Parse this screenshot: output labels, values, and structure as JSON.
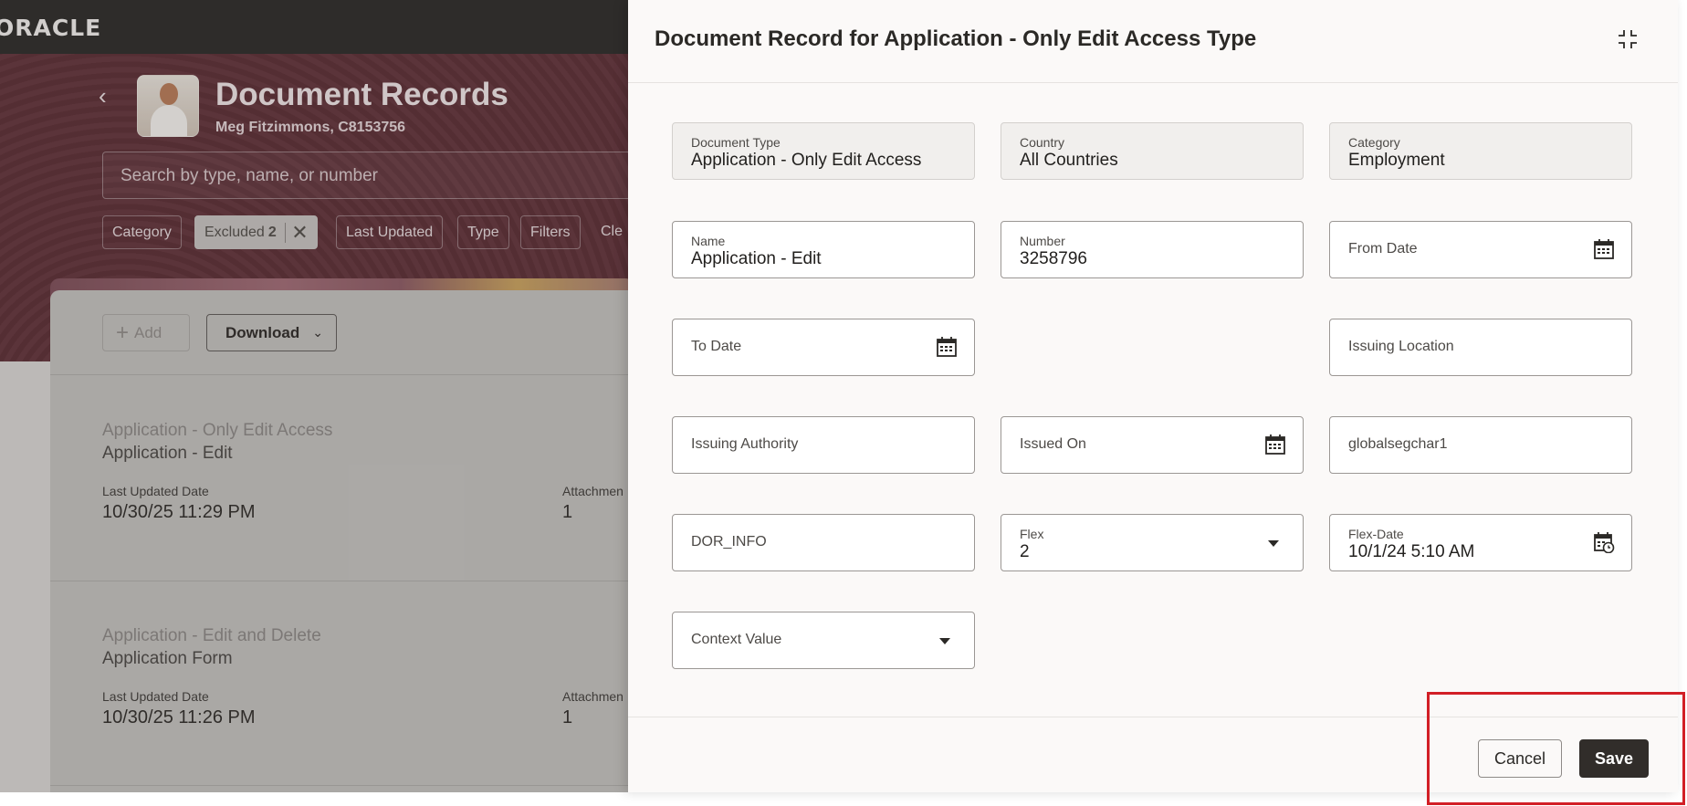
{
  "app": {
    "logo": "ORACLE"
  },
  "background": {
    "title": "Document Records",
    "subtitle": "Meg Fitzimmons, C8153756",
    "search_placeholder": "Search by type, name, or number",
    "chips": [
      {
        "label": "Category"
      },
      {
        "label": "Excluded",
        "count": "2"
      },
      {
        "label": "Last Updated"
      },
      {
        "label": "Type"
      },
      {
        "label": "Filters"
      },
      {
        "label": "Cle"
      }
    ],
    "add_label": "Add",
    "download_label": "Download",
    "records": [
      {
        "title": "Application - Only Edit Access",
        "name": "Application - Edit",
        "updated_label": "Last Updated Date",
        "updated": "10/30/25 11:29 PM",
        "attach_label": "Attachmen",
        "attach": "1"
      },
      {
        "title": "Application - Edit and Delete",
        "name": "Application Form",
        "updated_label": "Last Updated Date",
        "updated": "10/30/25 11:26 PM",
        "attach_label": "Attachmen",
        "attach": "1"
      }
    ]
  },
  "drawer": {
    "title": "Document Record for Application - Only Edit Access Type",
    "fields": {
      "document_type": {
        "label": "Document Type",
        "value": "Application - Only Edit Access"
      },
      "country": {
        "label": "Country",
        "value": "All Countries"
      },
      "category": {
        "label": "Category",
        "value": "Employment"
      },
      "name": {
        "label": "Name",
        "value": "Application - Edit"
      },
      "number": {
        "label": "Number",
        "value": "3258796"
      },
      "from_date": {
        "label": "From Date"
      },
      "to_date": {
        "label": "To Date"
      },
      "issuing_location": {
        "label": "Issuing Location"
      },
      "issuing_authority": {
        "label": "Issuing Authority"
      },
      "issued_on": {
        "label": "Issued On"
      },
      "globalsegchar1": {
        "label": "globalsegchar1"
      },
      "dor_info": {
        "label": "DOR_INFO"
      },
      "flex": {
        "label": "Flex",
        "value": "2"
      },
      "flex_date": {
        "label": "Flex-Date",
        "value": "10/1/24 5:10 AM"
      },
      "context_value": {
        "label": "Context Value"
      }
    },
    "cancel_label": "Cancel",
    "save_label": "Save"
  },
  "colors": {
    "hero": "#5d2d35",
    "save": "#312d2a",
    "highlight": "#d21f26"
  }
}
